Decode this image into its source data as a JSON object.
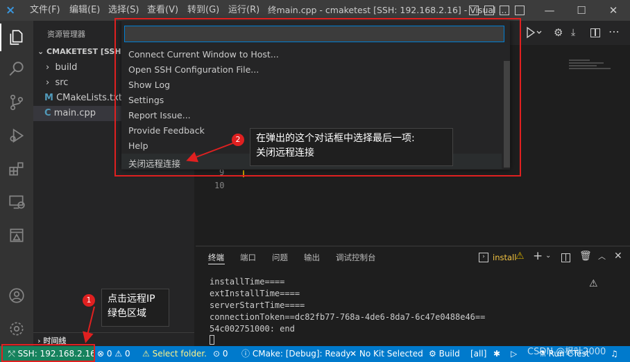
{
  "titlebar": {
    "menus": [
      "文件(F)",
      "编辑(E)",
      "选择(S)",
      "查看(V)",
      "转到(G)",
      "运行(R)"
    ],
    "window_title": "终main.cpp - cmaketest [SSH: 192.168.2.16] - Visual ..."
  },
  "sidebar": {
    "title": "资源管理器",
    "root": "CMAKETEST [SSH: 19",
    "items": [
      {
        "label": "build",
        "kind": "folder"
      },
      {
        "label": "src",
        "kind": "folder"
      },
      {
        "label": "CMakeLists.txt",
        "kind": "cmake",
        "icon": "M"
      },
      {
        "label": "main.cpp",
        "kind": "cpp",
        "icon": "C"
      }
    ],
    "timeline": "时间线"
  },
  "editor": {
    "line_numbers": [
      "9",
      "10"
    ]
  },
  "quickpick": {
    "items": [
      "Connect Current Window to Host...",
      "Open SSH Configuration File...",
      "Show Log",
      "Settings",
      "Report Issue...",
      "Provide Feedback",
      "Help",
      "关闭远程连接"
    ]
  },
  "panel": {
    "tabs": [
      "终端",
      "端口",
      "问题",
      "输出",
      "调试控制台"
    ],
    "terminal_name": "install",
    "terminal_lines": [
      "installTime====",
      "extInstallTime====",
      "serverStartTime====",
      "connectionToken==dc82fb77-768a-4de6-8da7-6c47e0488e46==",
      "54c002751000: end"
    ]
  },
  "statusbar": {
    "remote": "SSH: 192.168.2.16",
    "errors": "0",
    "warnings": "0",
    "select_folder": "Select folder.",
    "ports": "0",
    "cmake": "CMake: [Debug]: Ready",
    "kit": "No Kit Selected",
    "build": "Build",
    "target": "[all]",
    "run_ctest": "Run CTest"
  },
  "annotations": {
    "step1_number": "1",
    "step1_text_line1": "点击远程IP",
    "step1_text_line2": "绿色区域",
    "step2_number": "2",
    "step2_text_line1": "在弹出的这个对话框中选择最后一项:",
    "step2_text_line2": "关闭远程连接",
    "watermark": "CSDN @枫叶2000"
  },
  "colors": {
    "activity_bar": "#333333",
    "sidebar": "#252526",
    "editor": "#1e1e1e",
    "status_bar": "#007acc",
    "remote_indicator": "#16825d",
    "annotation_red": "#e02020"
  }
}
